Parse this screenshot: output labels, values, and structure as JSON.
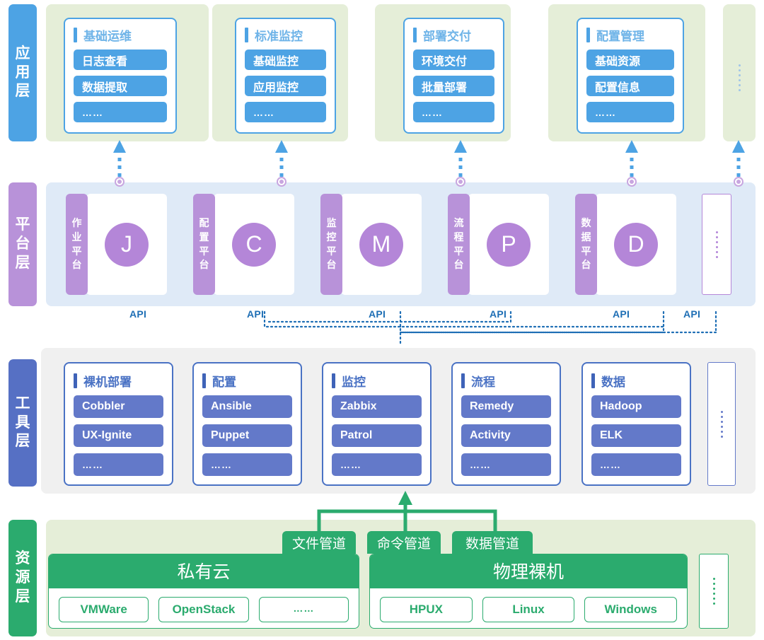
{
  "layers": [
    {
      "id": "application",
      "label_chars": [
        "应",
        "用",
        "层"
      ],
      "color": "#4da3e4"
    },
    {
      "id": "platform",
      "label_chars": [
        "平",
        "台",
        "层"
      ],
      "color": "#b892d9"
    },
    {
      "id": "tool",
      "label_chars": [
        "工",
        "具",
        "层"
      ],
      "color": "#5670c4"
    },
    {
      "id": "resource",
      "label_chars": [
        "资",
        "源",
        "层"
      ],
      "color": "#2bab6e"
    }
  ],
  "application": {
    "band_color": "#e5eed8",
    "accent": "#4da3e4",
    "cards": [
      {
        "title": "基础运维",
        "items": [
          "日志查看",
          "数据提取",
          "……"
        ]
      },
      {
        "title": "标准监控",
        "items": [
          "基础监控",
          "应用监控",
          "……"
        ]
      },
      {
        "title": "部署交付",
        "items": [
          "环境交付",
          "批量部署",
          "……"
        ]
      },
      {
        "title": "配置管理",
        "items": [
          "基础资源",
          "配置信息",
          "……"
        ]
      }
    ],
    "more_placeholder": "⋮"
  },
  "platform": {
    "band_color": "#dfeaf7",
    "accent": "#b486d8",
    "items": [
      {
        "label_chars": [
          "作",
          "业",
          "平",
          "台"
        ],
        "initial": "J"
      },
      {
        "label_chars": [
          "配",
          "置",
          "平",
          "台"
        ],
        "initial": "C"
      },
      {
        "label_chars": [
          "监",
          "控",
          "平",
          "台"
        ],
        "initial": "M"
      },
      {
        "label_chars": [
          "流",
          "程",
          "平",
          "台"
        ],
        "initial": "P"
      },
      {
        "label_chars": [
          "数",
          "据",
          "平",
          "台"
        ],
        "initial": "D"
      }
    ],
    "more_placeholder": "⋮",
    "api_label": "API",
    "api_labels": [
      "API",
      "API",
      "API",
      "API",
      "API",
      "API"
    ],
    "api_color": "#1f6fb5"
  },
  "tool": {
    "band_color": "#f0f0f0",
    "accent": "#4a72c4",
    "cards": [
      {
        "title": "裸机部署",
        "items": [
          "Cobbler",
          "UX-Ignite",
          "……"
        ]
      },
      {
        "title": "配置",
        "items": [
          "Ansible",
          "Puppet",
          "……"
        ]
      },
      {
        "title": "监控",
        "items": [
          "Zabbix",
          "Patrol",
          "……"
        ]
      },
      {
        "title": "流程",
        "items": [
          "Remedy",
          "Activity",
          "……"
        ]
      },
      {
        "title": "数据",
        "items": [
          "Hadoop",
          "ELK",
          "……"
        ]
      }
    ],
    "more_placeholder": "⋮"
  },
  "resource": {
    "band_color": "#e5eed8",
    "accent": "#2bab6e",
    "pipes": [
      "文件管道",
      "命令管道",
      "数据管道"
    ],
    "groups": [
      {
        "title": "私有云",
        "items": [
          "VMWare",
          "OpenStack",
          "……"
        ]
      },
      {
        "title": "物理裸机",
        "items": [
          "HPUX",
          "Linux",
          "Windows"
        ]
      }
    ],
    "more_placeholder": "⋮"
  }
}
